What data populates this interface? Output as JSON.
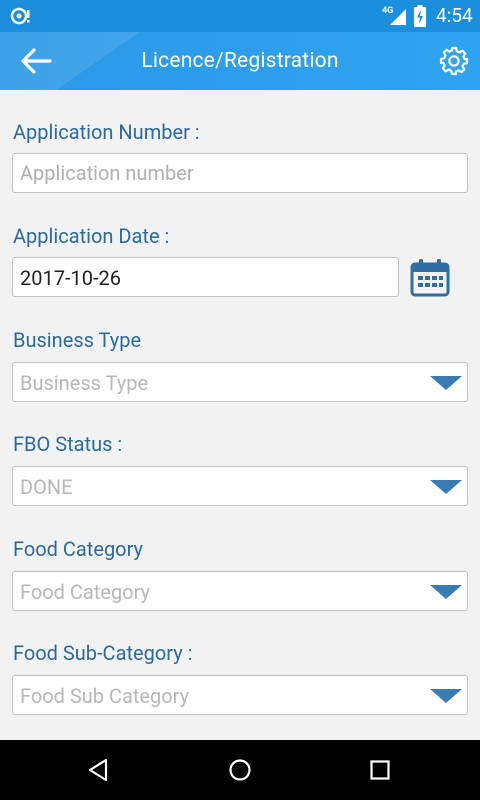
{
  "status_bar": {
    "network": "4G",
    "time": "4:54"
  },
  "app_bar": {
    "title": "Licence/Registration",
    "back_icon": "arrow-left-icon",
    "settings_icon": "gear-icon"
  },
  "form": {
    "application_number": {
      "label": "Application Number :",
      "placeholder": "Application number",
      "value": ""
    },
    "application_date": {
      "label": "Application Date :",
      "value": "2017-10-26",
      "icon": "calendar-icon"
    },
    "business_type": {
      "label": "Business Type",
      "selected": "Business Type"
    },
    "fbo_status": {
      "label": "FBO Status :",
      "selected": "DONE"
    },
    "food_category": {
      "label": "Food Category",
      "selected": "Food Category"
    },
    "food_sub_category": {
      "label": "Food Sub-Category :",
      "selected": "Food Sub Category"
    }
  },
  "colors": {
    "status_bar": "#1c8fdc",
    "app_bar": "#2a98e6",
    "label_text": "#2b6a9e",
    "dropdown_arrow": "#3b7bb3",
    "calendar_icon": "#2f6ea3",
    "background": "#f2f2f2"
  }
}
